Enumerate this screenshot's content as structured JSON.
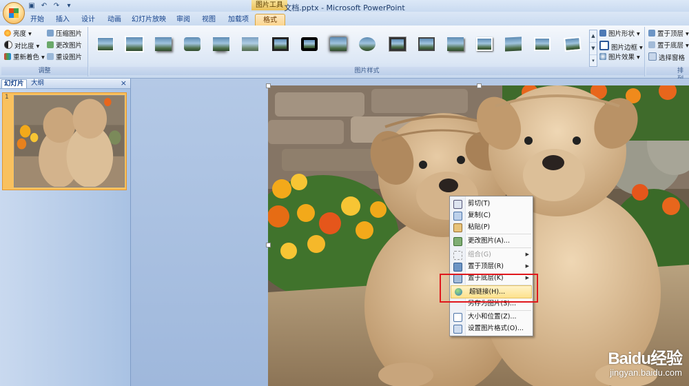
{
  "window": {
    "title": "文档.pptx - Microsoft PowerPoint",
    "context_tab_group": "图片工具"
  },
  "ribbon_tabs": [
    "开始",
    "插入",
    "设计",
    "动画",
    "幻灯片放映",
    "审阅",
    "视图",
    "加载项",
    "格式"
  ],
  "active_tab": "格式",
  "ribbon": {
    "adjust": {
      "label": "调整",
      "buttons": [
        "亮度",
        "压缩图片",
        "对比度",
        "更改图片",
        "重新着色",
        "重设图片"
      ]
    },
    "picture_styles": {
      "label": "图片样式",
      "options": [
        "图片形状",
        "图片边框",
        "图片效果"
      ]
    },
    "arrange": {
      "label": "排列",
      "options": [
        "置于顶层",
        "置于底层",
        "选择窗格"
      ]
    }
  },
  "slide_panel": {
    "tabs": [
      "幻灯片",
      "大纲"
    ],
    "close": "×",
    "slide_number": "1"
  },
  "context_menu": {
    "items": [
      {
        "label": "剪切(T)",
        "icon": "scissors-icon",
        "disabled": false,
        "submenu": false
      },
      {
        "label": "复制(C)",
        "icon": "copy-icon",
        "disabled": false,
        "submenu": false
      },
      {
        "label": "粘贴(P)",
        "icon": "paste-icon",
        "disabled": false,
        "submenu": false
      },
      {
        "label": "更改图片(A)...",
        "icon": "change-picture-icon",
        "disabled": false,
        "submenu": false
      },
      {
        "label": "组合(G)",
        "icon": "group-icon",
        "disabled": true,
        "submenu": true
      },
      {
        "label": "置于顶层(R)",
        "icon": "bring-to-front-icon",
        "disabled": false,
        "submenu": true
      },
      {
        "label": "置于底层(K)",
        "icon": "send-to-back-icon",
        "disabled": false,
        "submenu": true
      },
      {
        "label": "超链接(H)...",
        "icon": "hyperlink-icon",
        "disabled": false,
        "submenu": false,
        "highlighted": true
      },
      {
        "label": "另存为图片(S)...",
        "icon": "",
        "disabled": false,
        "submenu": false
      },
      {
        "label": "大小和位置(Z)...",
        "icon": "size-position-icon",
        "disabled": false,
        "submenu": false
      },
      {
        "label": "设置图片格式(O)...",
        "icon": "format-picture-icon",
        "disabled": false,
        "submenu": false
      }
    ]
  },
  "watermark": {
    "brand": "Baidu经验",
    "url": "jingyan.baidu.com"
  }
}
